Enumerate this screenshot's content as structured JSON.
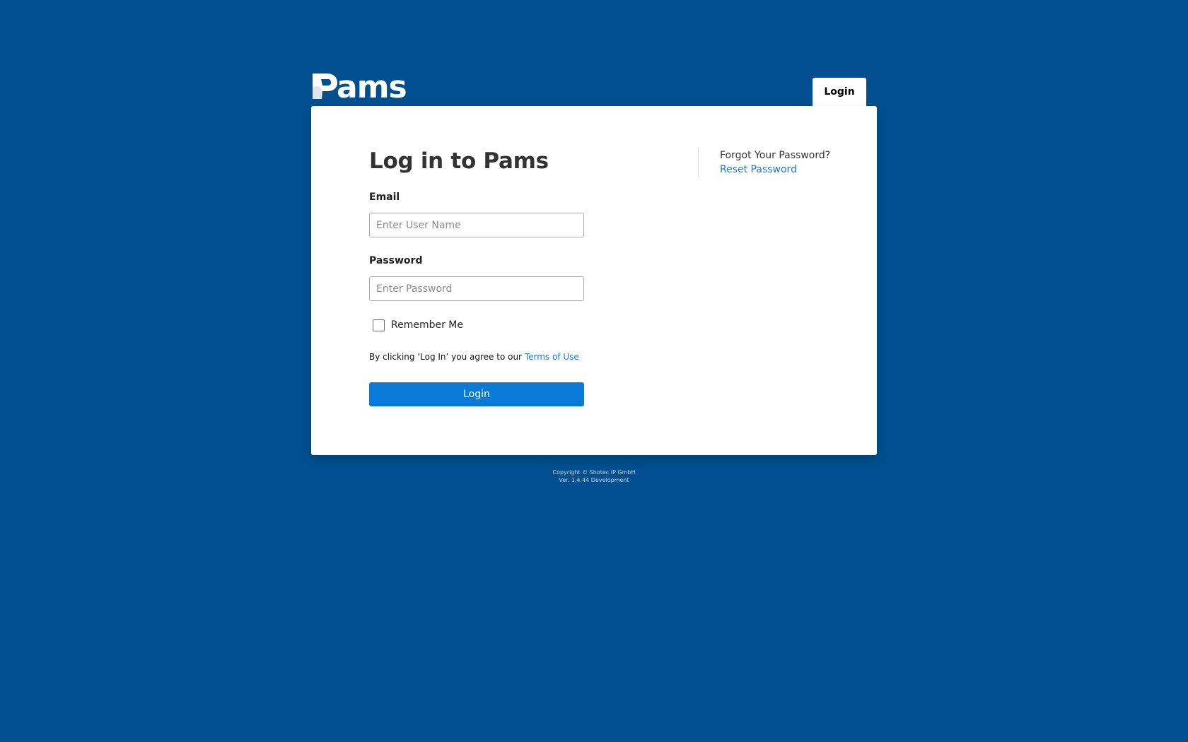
{
  "header": {
    "logo_text": "ams",
    "nav_tab_label": "Login"
  },
  "form": {
    "title": "Log in to Pams",
    "email_label": "Email",
    "email_placeholder": "Enter User Name",
    "email_value": "",
    "password_label": "Password",
    "password_placeholder": "Enter Password",
    "password_value": "",
    "remember_label": "Remember Me",
    "remember_checked": false,
    "terms_prefix": "By clicking ‘Log In’ you agree to our ",
    "terms_link": "Terms of Use",
    "submit_label": "Login"
  },
  "side": {
    "forgot_text": "Forgot Your Password?",
    "reset_link": "Reset Password"
  },
  "footer": {
    "copyright": "Copyright © Shotec IP GmbH",
    "version": "Ver. 1.4.44 Development"
  },
  "colors": {
    "background": "#014f8f",
    "primary_button": "#0a7ad8",
    "link": "#1f79c8"
  }
}
